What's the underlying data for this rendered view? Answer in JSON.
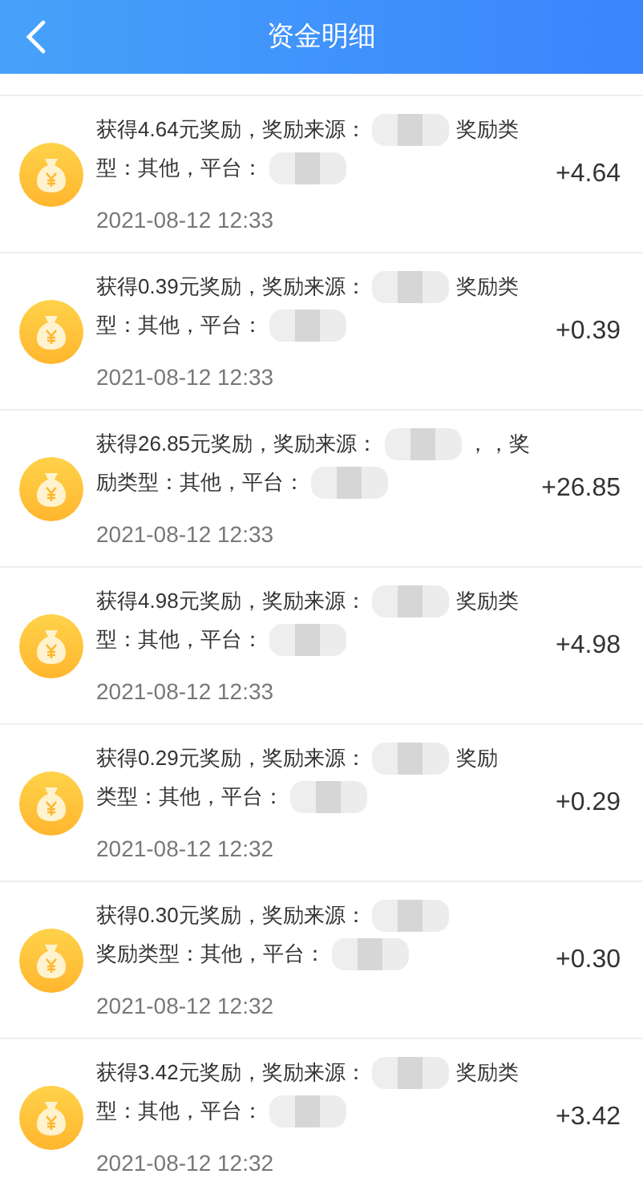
{
  "header": {
    "title": "资金明细"
  },
  "records": [
    {
      "lines": [
        [
          {
            "kind": "text",
            "text": "获得4.64元奖励，奖励来源："
          },
          {
            "kind": "blur"
          },
          {
            "kind": "text",
            "text": "奖励类"
          }
        ],
        [
          {
            "kind": "text",
            "text": "型：其他，平台："
          },
          {
            "kind": "blur"
          }
        ]
      ],
      "time": "2021-08-12 12:33",
      "amount": "+4.64"
    },
    {
      "lines": [
        [
          {
            "kind": "text",
            "text": "获得0.39元奖励，奖励来源："
          },
          {
            "kind": "blur"
          },
          {
            "kind": "text",
            "text": "奖励类"
          }
        ],
        [
          {
            "kind": "text",
            "text": "型：其他，平台："
          },
          {
            "kind": "blur"
          }
        ]
      ],
      "time": "2021-08-12 12:33",
      "amount": "+0.39"
    },
    {
      "lines": [
        [
          {
            "kind": "text",
            "text": "获得26.85元奖励，奖励来源："
          },
          {
            "kind": "blur"
          },
          {
            "kind": "text",
            "text": "，，奖"
          }
        ],
        [
          {
            "kind": "text",
            "text": "励类型：其他，平台："
          },
          {
            "kind": "blur"
          }
        ]
      ],
      "time": "2021-08-12 12:33",
      "amount": "+26.85"
    },
    {
      "lines": [
        [
          {
            "kind": "text",
            "text": "获得4.98元奖励，奖励来源："
          },
          {
            "kind": "blur"
          },
          {
            "kind": "text",
            "text": "奖励类"
          }
        ],
        [
          {
            "kind": "text",
            "text": "型：其他，平台："
          },
          {
            "kind": "blur"
          }
        ]
      ],
      "time": "2021-08-12 12:33",
      "amount": "+4.98"
    },
    {
      "lines": [
        [
          {
            "kind": "text",
            "text": "获得0.29元奖励，奖励来源："
          },
          {
            "kind": "blur"
          },
          {
            "kind": "text",
            "text": "奖励"
          }
        ],
        [
          {
            "kind": "text",
            "text": "类型：其他，平台："
          },
          {
            "kind": "blur"
          }
        ]
      ],
      "time": "2021-08-12 12:32",
      "amount": "+0.29"
    },
    {
      "lines": [
        [
          {
            "kind": "text",
            "text": "获得0.30元奖励，奖励来源："
          },
          {
            "kind": "blur"
          }
        ],
        [
          {
            "kind": "text",
            "text": "奖励类型：其他，平台："
          },
          {
            "kind": "blur"
          }
        ]
      ],
      "time": "2021-08-12 12:32",
      "amount": "+0.30"
    },
    {
      "lines": [
        [
          {
            "kind": "text",
            "text": "获得3.42元奖励，奖励来源："
          },
          {
            "kind": "blur"
          },
          {
            "kind": "text",
            "text": "奖励类"
          }
        ],
        [
          {
            "kind": "text",
            "text": "型：其他，平台："
          },
          {
            "kind": "blur"
          }
        ]
      ],
      "time": "2021-08-12 12:32",
      "amount": "+3.42"
    }
  ]
}
